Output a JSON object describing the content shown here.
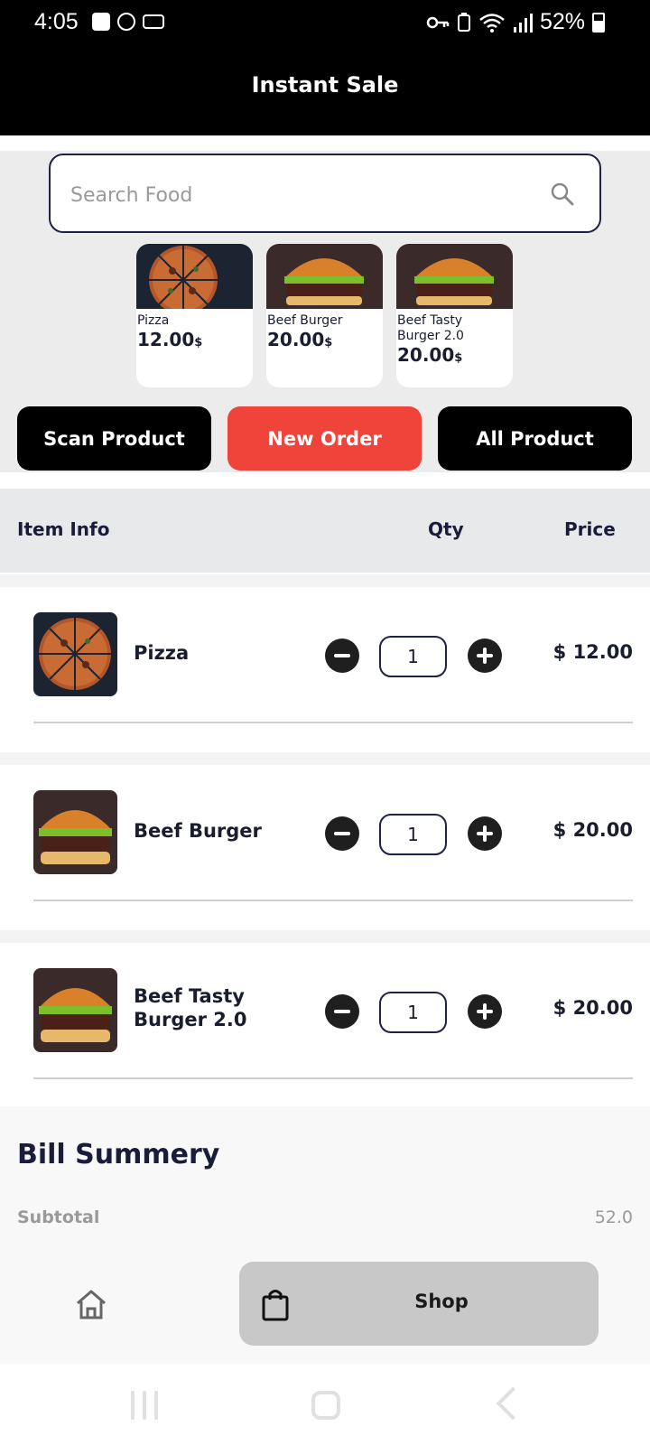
{
  "status_bar": {
    "time": "4:05",
    "battery": "52%"
  },
  "header": {
    "title": "Instant Sale"
  },
  "search": {
    "placeholder": "Search Food",
    "value": ""
  },
  "quick_products": [
    {
      "name": "Pizza",
      "price": "12.00",
      "currency": "$",
      "image": "pizza"
    },
    {
      "name": "Beef Burger",
      "price": "20.00",
      "currency": "$",
      "image": "burger"
    },
    {
      "name": "Beef Tasty Burger 2.0",
      "price": "20.00",
      "currency": "$",
      "image": "burger"
    }
  ],
  "actions": {
    "scan": "Scan Product",
    "new_order": "New Order",
    "all": "All Product"
  },
  "table": {
    "headers": {
      "item": "Item Info",
      "qty": "Qty",
      "price": "Price"
    },
    "rows": [
      {
        "name": "Pizza",
        "qty": "1",
        "price": "$ 12.00",
        "image": "pizza"
      },
      {
        "name": "Beef Burger",
        "qty": "1",
        "price": "$ 20.00",
        "image": "burger"
      },
      {
        "name": "Beef Tasty Burger 2.0",
        "qty": "1",
        "price": "$ 20.00",
        "image": "burger"
      }
    ]
  },
  "bill": {
    "title": "Bill Summery",
    "subtotal_label": "Subtotal",
    "subtotal_value": "52.0"
  },
  "bottom_nav": {
    "shop_label": "Shop"
  },
  "colors": {
    "accent": "#f0433a",
    "dark": "#000000",
    "header_bg": "#000000"
  }
}
